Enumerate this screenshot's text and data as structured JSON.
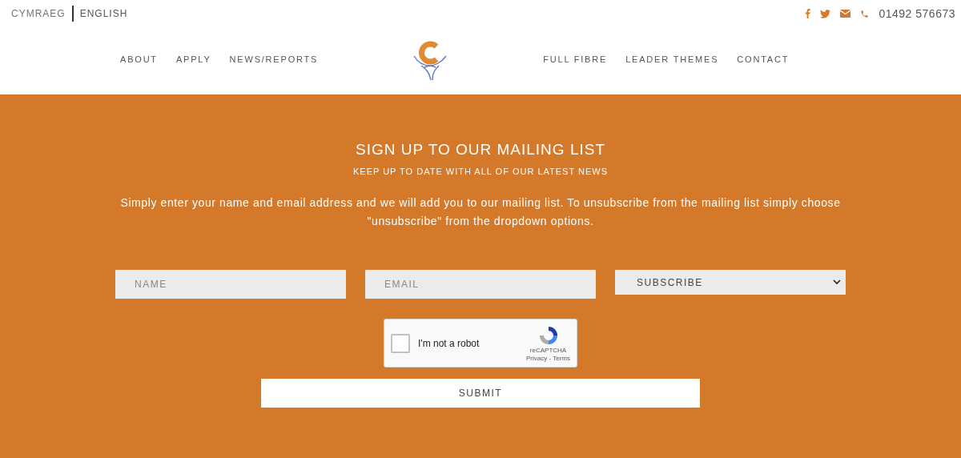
{
  "language_switch": [
    {
      "label": "CYMRAEG",
      "selected": false
    },
    {
      "label": "ENGLISH",
      "selected": true
    }
  ],
  "contact": {
    "phone": "01492 576673"
  },
  "nav_left": [
    "ABOUT",
    "APPLY",
    "NEWS/REPORTS"
  ],
  "nav_right": [
    "FULL FIBRE",
    "LEADER THEMES",
    "CONTACT"
  ],
  "signup": {
    "title": "SIGN UP TO OUR MAILING LIST",
    "subtitle": "KEEP UP TO DATE WITH ALL OF OUR LATEST NEWS",
    "intro": "Simply enter your name and email address and we will add you to our mailing list. To unsubscribe from the mailing list simply choose \"unsubscribe\" from the dropdown options.",
    "name_placeholder": "NAME",
    "email_placeholder": "EMAIL",
    "action": "SUBSCRIBE",
    "captcha": {
      "label": "I'm not a robot",
      "checked": false,
      "brand": "reCAPTCHA",
      "links": "Privacy - Terms"
    },
    "submit": "SUBMIT"
  }
}
